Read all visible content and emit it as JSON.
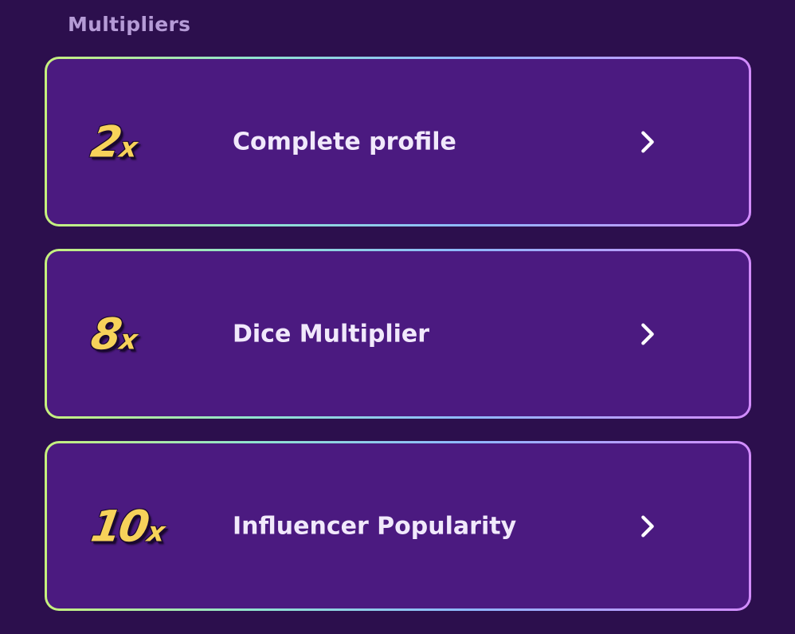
{
  "section": {
    "title": "Multipliers"
  },
  "multipliers": [
    {
      "value": "2",
      "suffix": "x",
      "label": "Complete profile",
      "icon": "chevron-right-icon"
    },
    {
      "value": "8",
      "suffix": "x",
      "label": "Dice Multiplier",
      "icon": "chevron-right-icon"
    },
    {
      "value": "10",
      "suffix": "x",
      "label": "Influencer Popularity",
      "icon": "chevron-right-icon"
    }
  ],
  "colors": {
    "background": "#2c0f4d",
    "card": "#4b1a80",
    "multiplier": "#f7d25a",
    "label": "#f1e9fb",
    "title": "#b59bd6"
  }
}
